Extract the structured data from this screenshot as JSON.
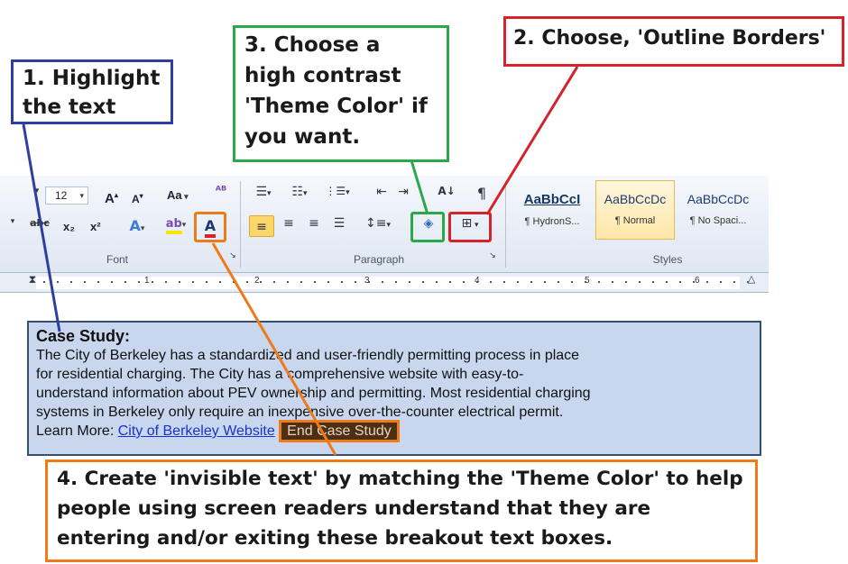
{
  "callouts": {
    "step1": "1. Highlight the text",
    "step2": "2. Choose, 'Outline Borders'",
    "step3": "3. Choose a high contrast 'Theme Color' if you want.",
    "step4": "4. Create 'invisible text' by matching the 'Theme Color' to help people using screen readers understand that they are entering and/or exiting these breakout text boxes."
  },
  "colors": {
    "step1": "#2e3fa0",
    "step2": "#d4232a",
    "step3": "#2aa84a",
    "step4": "#ef7a1a",
    "case_bg": "#c8d7ee",
    "end_bg": "#4d3014"
  },
  "ribbon": {
    "font_group": "Font",
    "paragraph_group": "Paragraph",
    "styles_group": "Styles",
    "font_size": "12",
    "grow_font": "A",
    "shrink_font": "A",
    "change_case": "Aa",
    "subscript": "x₂",
    "superscript": "x²",
    "font_color_letter": "A",
    "styles": [
      {
        "preview": "AaBbCcI",
        "name": "¶ HydronS..."
      },
      {
        "preview": "AaBbCcDc",
        "name": "¶ Normal"
      },
      {
        "preview": "AaBbCcDc",
        "name": "¶ No Spaci..."
      }
    ]
  },
  "ruler": {
    "numbers": [
      "1",
      "2",
      "3",
      "4",
      "5",
      "6"
    ]
  },
  "case_study": {
    "title": "Case Study:",
    "line1": "The City of Berkeley has a standardized and user-friendly permitting process in place",
    "line2": "for residential charging.  The City has a comprehensive website with easy-to-",
    "line3": "understand information about PEV ownership and permitting.  Most residential charging",
    "line4": "systems in Berkeley only require an inexpensive over-the-counter electrical permit.",
    "learn_more": "Learn More:",
    "link": "City of Berkeley Website",
    "end_marker": "End Case Study"
  }
}
